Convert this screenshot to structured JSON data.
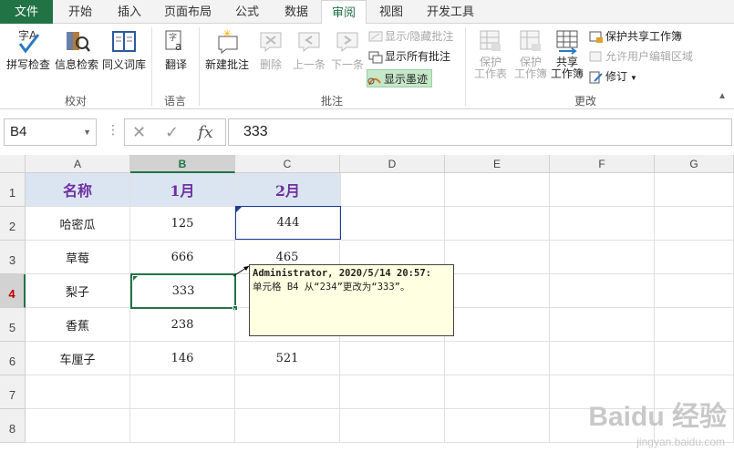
{
  "tabs": [
    "文件",
    "开始",
    "插入",
    "页面布局",
    "公式",
    "数据",
    "审阅",
    "视图",
    "开发工具"
  ],
  "active_tab": "审阅",
  "ribbon": {
    "proofing": {
      "label": "校对",
      "spell": "拼写检查",
      "research": "信息检索",
      "thesaurus": "同义词库"
    },
    "language": {
      "label": "语言",
      "translate": "翻译"
    },
    "comments": {
      "label": "批注",
      "new": "新建批注",
      "delete": "删除",
      "prev": "上一条",
      "next": "下一条",
      "show_hide": "显示/隐藏批注",
      "show_all": "显示所有批注",
      "show_ink": "显示墨迹"
    },
    "changes": {
      "label": "更改",
      "protect_sheet_1": "保护",
      "protect_sheet_2": "工作表",
      "protect_wb_1": "保护",
      "protect_wb_2": "工作簿",
      "share_1": "共享",
      "share_2": "工作簿",
      "protect_share": "保护共享工作簿",
      "allow_edit": "允许用户编辑区域",
      "track": "修订"
    }
  },
  "formula_bar": {
    "name_box": "B4",
    "fx": "fx",
    "value": "333"
  },
  "columns": [
    "A",
    "B",
    "C",
    "D",
    "E",
    "F",
    "G"
  ],
  "rows": [
    "1",
    "2",
    "3",
    "4",
    "5",
    "6",
    "7",
    "8"
  ],
  "cells": {
    "A1": "名称",
    "B1": "1月",
    "C1": "2月",
    "A2": "哈密瓜",
    "B2": "125",
    "C2": "444",
    "A3": "草莓",
    "B3": "666",
    "C3": "465",
    "A4": "梨子",
    "B4": "333",
    "A5": "香蕉",
    "B5": "238",
    "A6": "车厘子",
    "B6": "146",
    "C6": "521"
  },
  "comment": {
    "author": "Administrator, 2020/5/14 20:57:",
    "text": "单元格 B4 从“234”更改为“333”。"
  },
  "watermark": {
    "main": "Baidu 经验",
    "sub": "jingyan.baidu.com"
  },
  "colors": {
    "accent": "#217346",
    "header_fill": "#dbe5f1",
    "header_text": "#7030a0",
    "comment_bg": "#ffffe1"
  }
}
